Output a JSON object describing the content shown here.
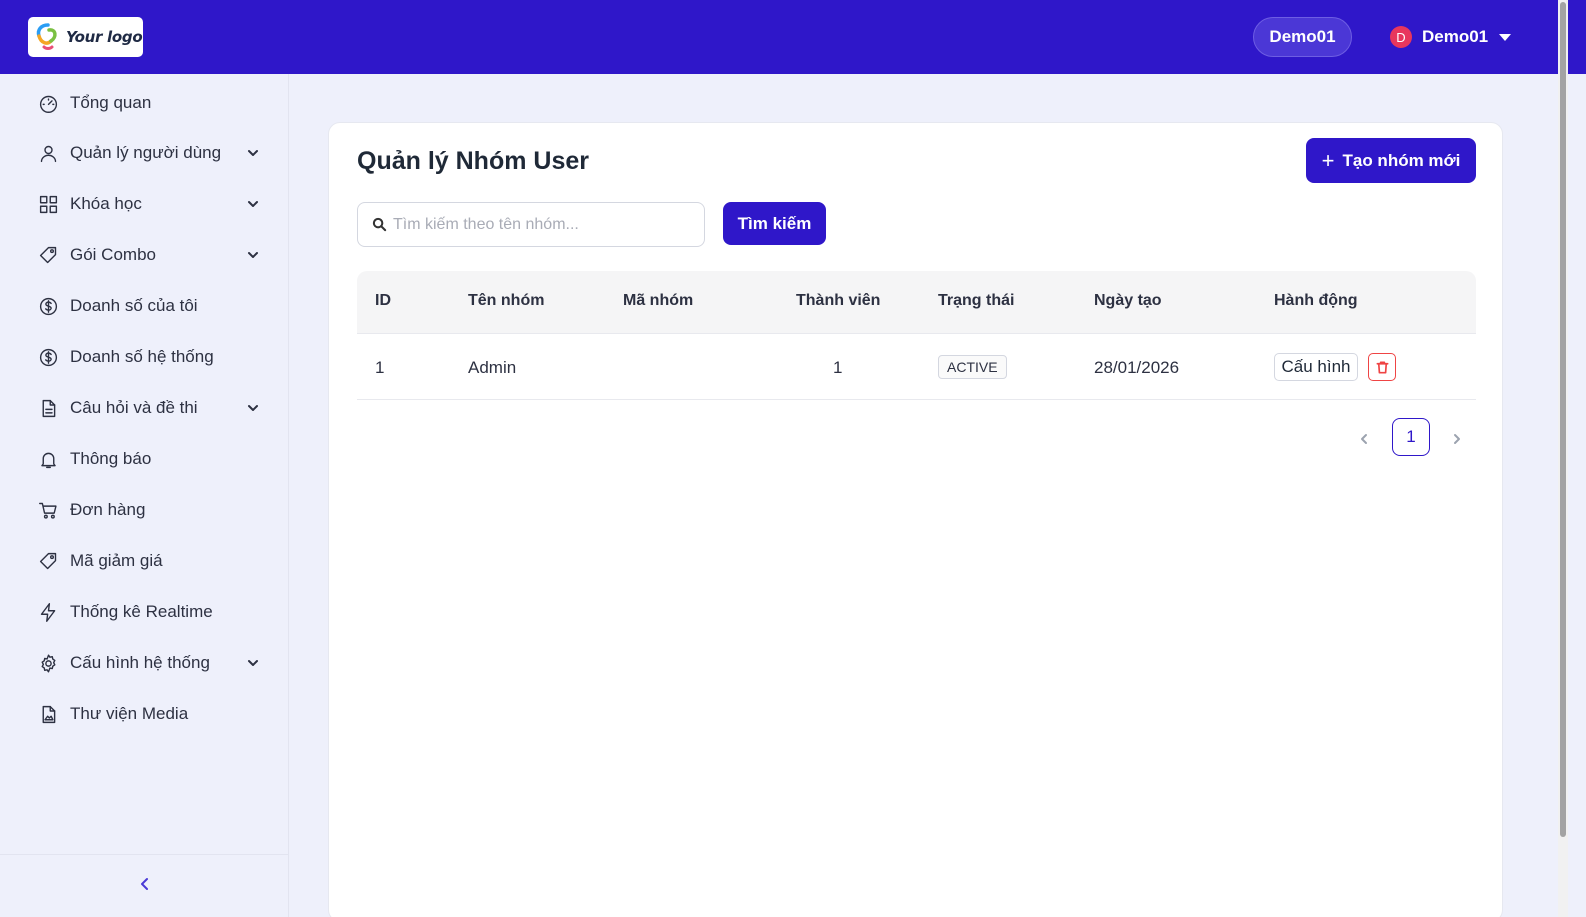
{
  "header": {
    "logo_text": "Your logo",
    "tenant_label": "Demo01",
    "user": {
      "initial": "D",
      "name": "Demo01"
    }
  },
  "sidebar": {
    "items": [
      {
        "label": "Tổng quan",
        "icon": "dashboard-icon",
        "expandable": false
      },
      {
        "label": "Quản lý người dùng",
        "icon": "user-icon",
        "expandable": true
      },
      {
        "label": "Khóa học",
        "icon": "grid-icon",
        "expandable": true
      },
      {
        "label": "Gói Combo",
        "icon": "tag-icon",
        "expandable": true
      },
      {
        "label": "Doanh số của tôi",
        "icon": "dollar-icon",
        "expandable": false
      },
      {
        "label": "Doanh số hệ thống",
        "icon": "dollar-icon",
        "expandable": false
      },
      {
        "label": "Câu hỏi và đề thi",
        "icon": "document-icon",
        "expandable": true
      },
      {
        "label": "Thông báo",
        "icon": "bell-icon",
        "expandable": false
      },
      {
        "label": "Đơn hàng",
        "icon": "cart-icon",
        "expandable": false
      },
      {
        "label": "Mã giảm giá",
        "icon": "tag-icon",
        "expandable": false
      },
      {
        "label": "Thống kê Realtime",
        "icon": "lightning-icon",
        "expandable": false
      },
      {
        "label": "Cấu hình hệ thống",
        "icon": "gear-icon",
        "expandable": true
      },
      {
        "label": "Thư viện Media",
        "icon": "image-file-icon",
        "expandable": false
      }
    ],
    "collapse_icon": "chevron-left-icon"
  },
  "main": {
    "title": "Quản lý Nhóm User",
    "create_button": "Tạo nhóm mới",
    "search": {
      "placeholder": "Tìm kiếm theo tên nhóm...",
      "value": "",
      "button": "Tìm kiếm"
    },
    "table": {
      "columns": [
        "ID",
        "Tên nhóm",
        "Mã nhóm",
        "Thành viên",
        "Trạng thái",
        "Ngày tạo",
        "Hành động"
      ],
      "rows": [
        {
          "id": "1",
          "name": "Admin",
          "code": "",
          "members": "1",
          "status": "ACTIVE",
          "created": "28/01/2026",
          "action_label": "Cấu hình"
        }
      ]
    },
    "pagination": {
      "current_page": "1"
    }
  },
  "colors": {
    "primary": "#2f17c9",
    "danger": "#ef4444",
    "background": "#eef0fb"
  }
}
